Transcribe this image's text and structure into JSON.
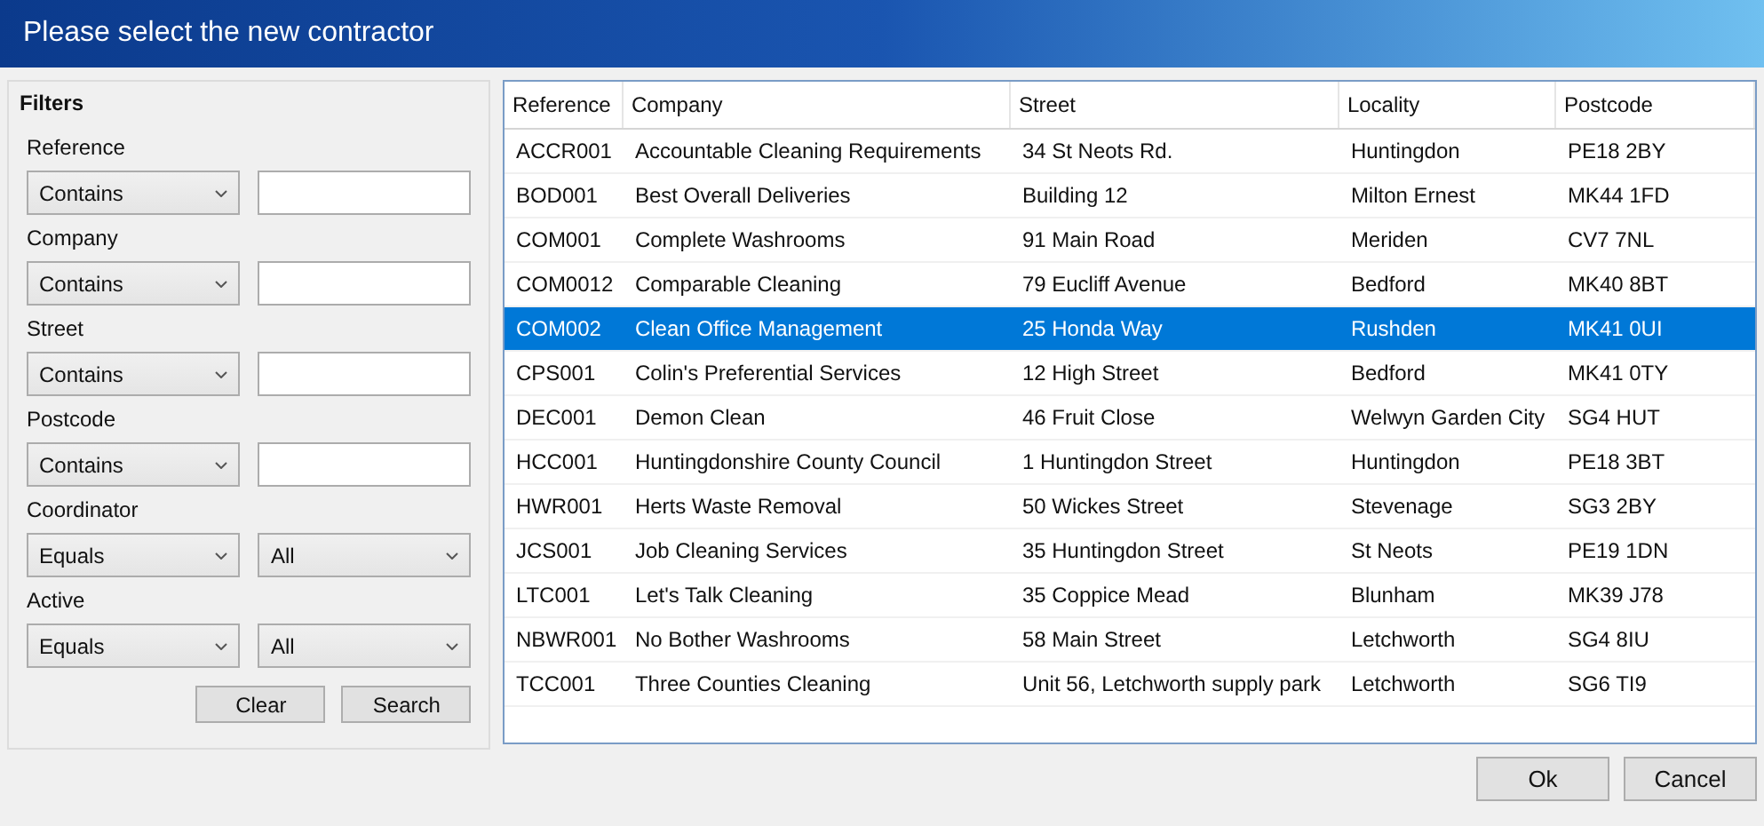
{
  "window": {
    "title": "Please select the new contractor"
  },
  "filters": {
    "title": "Filters",
    "items": [
      {
        "label": "Reference",
        "operator": "Contains",
        "kind": "text",
        "value": ""
      },
      {
        "label": "Company",
        "operator": "Contains",
        "kind": "text",
        "value": ""
      },
      {
        "label": "Street",
        "operator": "Contains",
        "kind": "text",
        "value": ""
      },
      {
        "label": "Postcode",
        "operator": "Contains",
        "kind": "text",
        "value": ""
      },
      {
        "label": "Coordinator",
        "operator": "Equals",
        "kind": "select",
        "value": "All"
      },
      {
        "label": "Active",
        "operator": "Equals",
        "kind": "select",
        "value": "All"
      }
    ],
    "buttons": [
      "Clear",
      "Search"
    ]
  },
  "table": {
    "columns": [
      "Reference",
      "Company",
      "Street",
      "Locality",
      "Postcode"
    ],
    "rows": [
      {
        "cells": [
          "ACCR001",
          "Accountable Cleaning Requirements",
          "34 St Neots Rd.",
          "Huntingdon",
          "PE18 2BY"
        ],
        "selected": false
      },
      {
        "cells": [
          "BOD001",
          "Best Overall Deliveries",
          "Building 12",
          "Milton Ernest",
          "MK44 1FD"
        ],
        "selected": false
      },
      {
        "cells": [
          "COM001",
          "Complete Washrooms",
          "91 Main Road",
          "Meriden",
          "CV7 7NL"
        ],
        "selected": false
      },
      {
        "cells": [
          "COM0012",
          "Comparable Cleaning",
          "79 Eucliff Avenue",
          "Bedford",
          "MK40 8BT"
        ],
        "selected": false
      },
      {
        "cells": [
          "COM002",
          "Clean Office Management",
          "25 Honda Way",
          "Rushden",
          "MK41 0UI"
        ],
        "selected": true
      },
      {
        "cells": [
          "CPS001",
          "Colin's Preferential Services",
          "12 High Street",
          "Bedford",
          "MK41 0TY"
        ],
        "selected": false
      },
      {
        "cells": [
          "DEC001",
          "Demon Clean",
          "46 Fruit Close",
          "Welwyn Garden City",
          "SG4 HUT"
        ],
        "selected": false
      },
      {
        "cells": [
          "HCC001",
          "Huntingdonshire County Council",
          "1 Huntingdon Street",
          "Huntingdon",
          "PE18 3BT"
        ],
        "selected": false
      },
      {
        "cells": [
          "HWR001",
          "Herts Waste Removal",
          "50 Wickes Street",
          "Stevenage",
          "SG3 2BY"
        ],
        "selected": false
      },
      {
        "cells": [
          "JCS001",
          "Job Cleaning Services",
          "35 Huntingdon Street",
          "St Neots",
          "PE19 1DN"
        ],
        "selected": false
      },
      {
        "cells": [
          "LTC001",
          "Let's Talk Cleaning",
          "35 Coppice Mead",
          "Blunham",
          "MK39 J78"
        ],
        "selected": false
      },
      {
        "cells": [
          "NBWR001",
          "No Bother Washrooms",
          "58 Main Street",
          "Letchworth",
          "SG4 8IU"
        ],
        "selected": false
      },
      {
        "cells": [
          "TCC001",
          "Three Counties Cleaning",
          "Unit 56, Letchworth supply park",
          "Letchworth",
          "SG6 TI9"
        ],
        "selected": false
      }
    ]
  },
  "buttons": [
    "Ok",
    "Cancel"
  ]
}
